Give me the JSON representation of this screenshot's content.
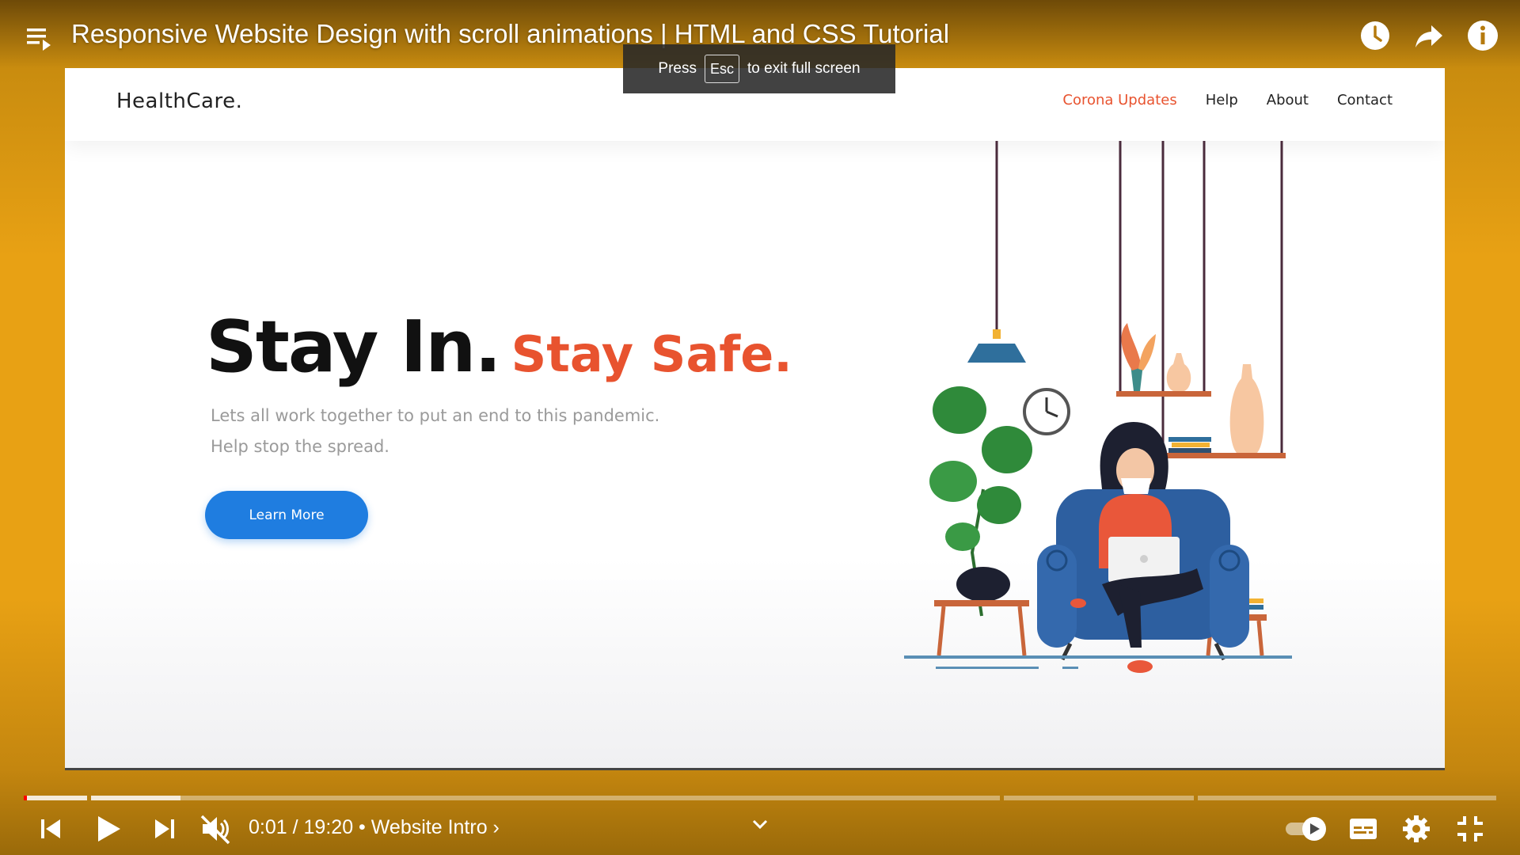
{
  "video": {
    "title": "Responsive Website Design with scroll animations | HTML and CSS Tutorial"
  },
  "tooltip": {
    "press": "Press",
    "key": "Esc",
    "suffix": "to exit full screen"
  },
  "website": {
    "logo": "HealthCare.",
    "nav": [
      "Corona Updates",
      "Help",
      "About",
      "Contact"
    ],
    "hero_title_1": "Stay In.",
    "hero_title_2": "Stay Safe.",
    "hero_line_1": "Lets all work together to put an end to this pandemic.",
    "hero_line_2": "Help stop the spread.",
    "button": "Learn More",
    "accent_color": "#e8532f",
    "button_color": "#1f7de0"
  },
  "player": {
    "current_time": "0:01",
    "duration": "19:20",
    "separator": "•",
    "chapter": "Website Intro",
    "progress_fraction": 0.001
  },
  "icons": {
    "top": [
      "playlist-icon",
      "watch-later-icon",
      "share-icon",
      "info-icon"
    ],
    "bottom": [
      "previous-icon",
      "play-icon",
      "next-icon",
      "mute-icon",
      "chevron-down-icon",
      "autoplay-toggle",
      "subtitles-icon",
      "settings-icon",
      "exit-fullscreen-icon"
    ]
  }
}
